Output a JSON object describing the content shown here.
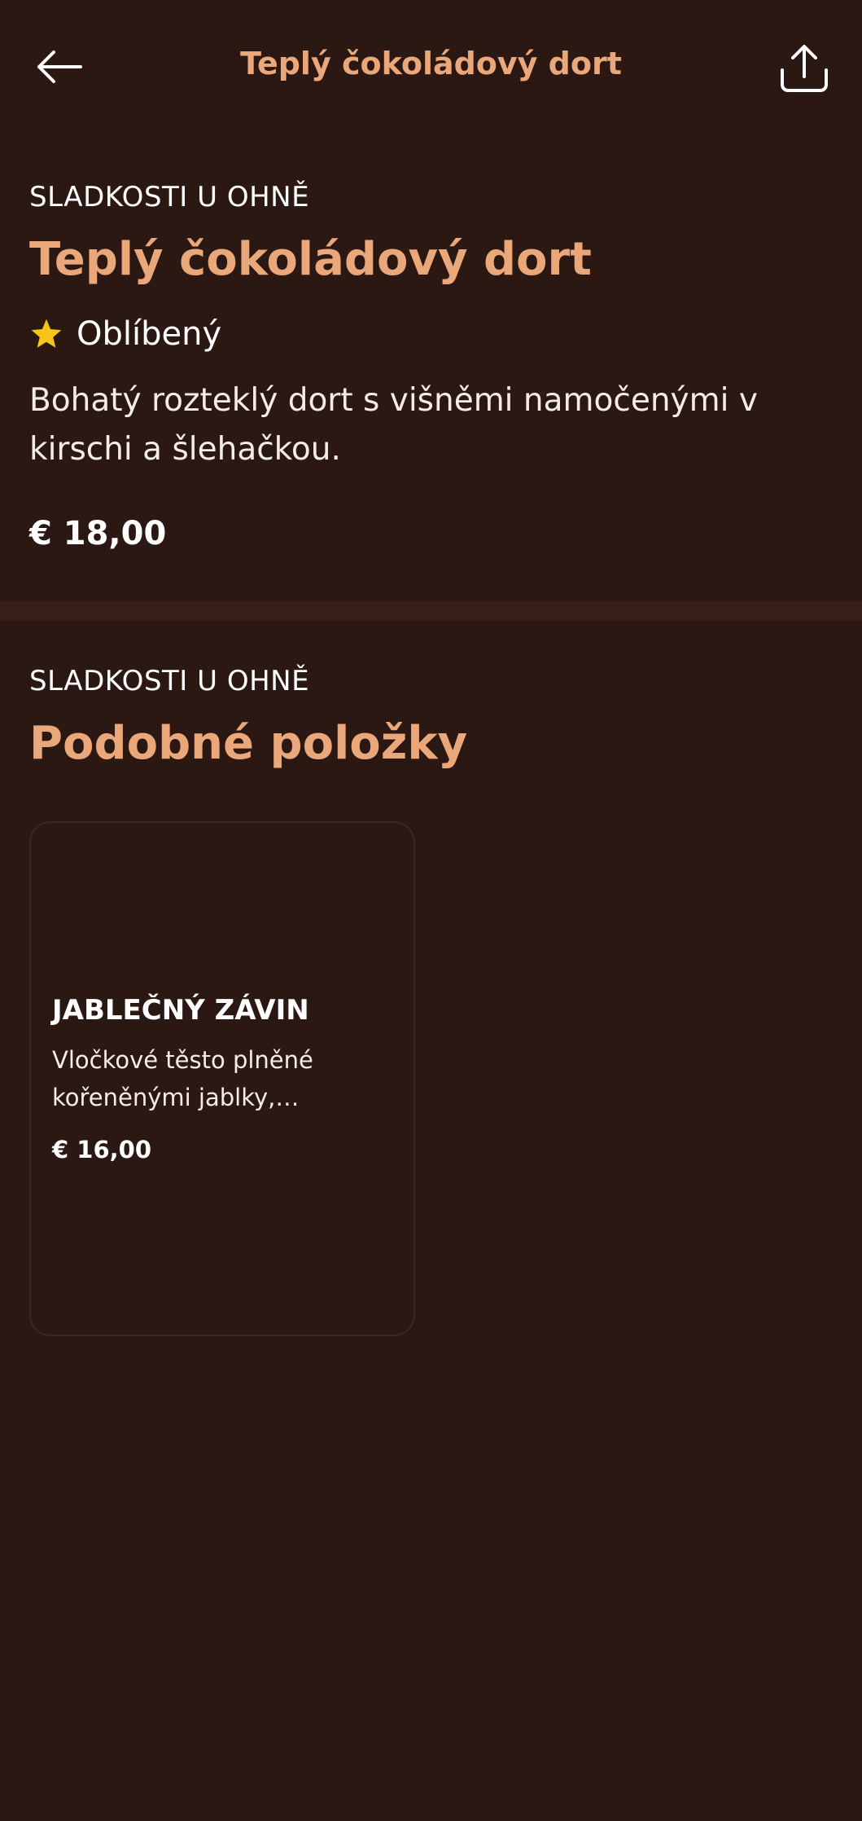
{
  "header": {
    "title": "Teplý čokoládový dort"
  },
  "item": {
    "category": "SLADKOSTI U OHNĚ",
    "name": "Teplý čokoládový dort",
    "badge": "Oblíbený",
    "description": "Bohatý rozteklý dort s višněmi namočenými v kirschi a šlehačkou.",
    "price": "€ 18,00"
  },
  "similar": {
    "category": "SLADKOSTI U OHNĚ",
    "title": "Podobné položky",
    "items": [
      {
        "name": "JABLEČNÝ ZÁVIN",
        "description": "Vločkové těsto plněné kořeněnými jablky, rozinkami a skořicí.",
        "price": "€ 16,00"
      }
    ]
  },
  "colors": {
    "background": "#2c1813",
    "accent": "#e9a77a",
    "star": "#f5c518"
  },
  "icons": {
    "back": "arrow-left-icon",
    "share": "share-icon",
    "favorite": "star-icon"
  }
}
